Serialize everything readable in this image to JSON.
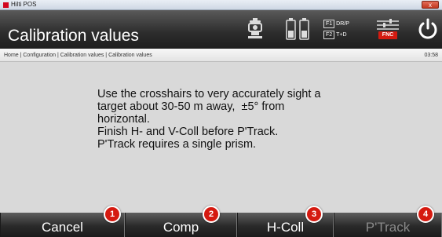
{
  "window": {
    "title": "Hilti POS",
    "close_symbol": "x"
  },
  "header": {
    "title": "Calibration values",
    "icons": [
      "instrument-icon",
      "battery-icon",
      "face-mode-icon",
      "fnc-icon",
      "power-icon"
    ],
    "face_mode": {
      "key1": "F1",
      "label1": "DR/P",
      "key2": "F2",
      "label2": "T+D"
    },
    "fnc_label": "FNC"
  },
  "breadcrumb": {
    "path": "Home | Configuration | Calibration values | Calibration values",
    "time": "03:58"
  },
  "message": {
    "lines": [
      "Use the crosshairs to very accurately sight a",
      "target about 30-50 m away,  ±5° from",
      "horizontal.",
      "Finish H- and V-Coll before P'Track.",
      "P'Track requires a single prism."
    ]
  },
  "footer": {
    "buttons": [
      {
        "label": "Cancel",
        "badge": "1",
        "enabled": true
      },
      {
        "label": "Comp",
        "badge": "2",
        "enabled": true
      },
      {
        "label": "H-Coll",
        "badge": "3",
        "enabled": true
      },
      {
        "label": "P'Track",
        "badge": "4",
        "enabled": false
      }
    ]
  },
  "colors": {
    "accent_red": "#d51a10",
    "header_dark": "#2c2c2c",
    "content_bg": "#d9d9d9"
  }
}
